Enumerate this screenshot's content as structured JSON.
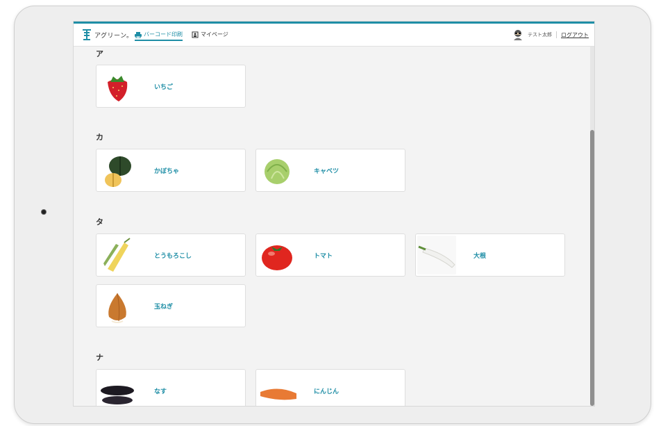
{
  "header": {
    "logo_text": "アグリーン。",
    "tabs": [
      {
        "label": "バーコード印刷",
        "active": true
      },
      {
        "label": "マイページ",
        "active": false
      }
    ],
    "user_name": "テスト太郎",
    "logout_label": "ログアウト"
  },
  "sections": [
    {
      "heading": "ア",
      "items": [
        {
          "name": "いちご",
          "icon": "strawberry-icon"
        }
      ]
    },
    {
      "heading": "カ",
      "items": [
        {
          "name": "かぼちゃ",
          "icon": "pumpkin-icon"
        },
        {
          "name": "キャベツ",
          "icon": "cabbage-icon"
        }
      ]
    },
    {
      "heading": "タ",
      "items": [
        {
          "name": "とうもろこし",
          "icon": "corn-icon"
        },
        {
          "name": "トマト",
          "icon": "tomato-icon"
        },
        {
          "name": "大根",
          "icon": "daikon-icon"
        },
        {
          "name": "玉ねぎ",
          "icon": "onion-icon"
        }
      ]
    },
    {
      "heading": "ナ",
      "items": [
        {
          "name": "なす",
          "icon": "eggplant-icon"
        },
        {
          "name": "にんじん",
          "icon": "carrot-icon"
        }
      ]
    }
  ],
  "colors": {
    "accent": "#1f8ea6"
  }
}
